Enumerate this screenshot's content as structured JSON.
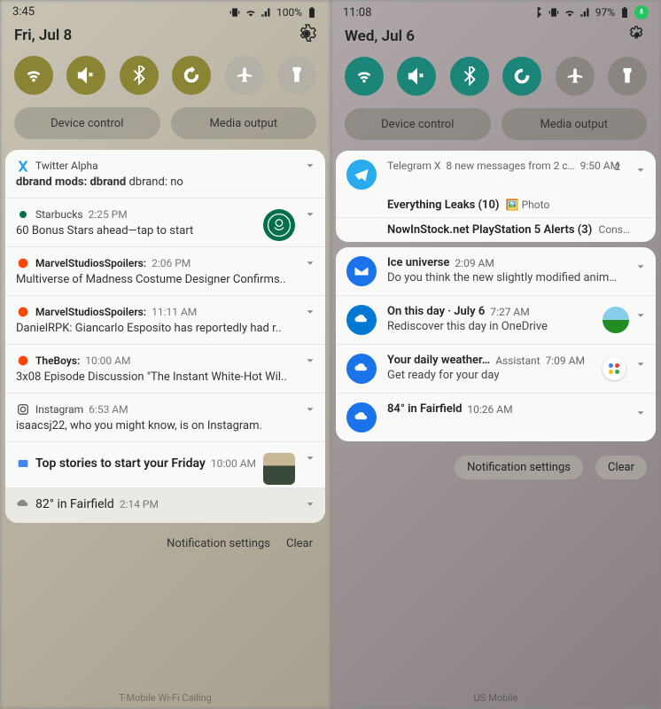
{
  "left": {
    "time": "3:45",
    "battery": "100%",
    "date": "Fri, Jul 8",
    "device_control": "Device control",
    "media_output": "Media output",
    "notifs": [
      {
        "app": "Twitter Alpha",
        "title": "dbrand mods: dbrand",
        "body": "dbrand: no"
      },
      {
        "app": "Starbucks",
        "time": "2:25 PM",
        "body": "60 Bonus Stars ahead—tap to start"
      },
      {
        "app": "MarvelStudiosSpoilers:",
        "time": "2:06 PM",
        "body": "Multiverse of Madness Costume Designer Confirms.."
      },
      {
        "app": "MarvelStudiosSpoilers:",
        "time": "11:11 AM",
        "body": "DanielRPK: Giancarlo Esposito has reportedly had r.."
      },
      {
        "app": "TheBoys:",
        "time": "10:00 AM",
        "body": "3x08 Episode Discussion \"The Instant White-Hot Wil.."
      },
      {
        "app": "Instagram",
        "time": "6:53 AM",
        "body": "isaacsj22, who you might know, is on Instagram."
      },
      {
        "title": "Top stories to start your Friday",
        "time": "10:00 AM"
      },
      {
        "title": "82° in Fairfield",
        "time": "2:14 PM"
      }
    ],
    "notif_settings": "Notification settings",
    "clear": "Clear",
    "carrier": "T-Mobile Wi-Fi Calling"
  },
  "right": {
    "time": "11:08",
    "battery": "97%",
    "date": "Wed, Jul 6",
    "device_control": "Device control",
    "media_output": "Media output",
    "telegram": {
      "app": "Telegram X",
      "summary": "8 new messages from 2 c…",
      "time": "9:50 AM",
      "count": "2",
      "sub1_title": "Everything Leaks (10)",
      "sub1_meta": "🖼️ Photo",
      "sub2_title": "NowInStock.net PlayStation 5 Alerts (3)",
      "sub2_meta": "Cons…"
    },
    "notifs": [
      {
        "app": "Ice universe",
        "time": "2:09 AM",
        "body": "Do you think the new slightly modified anim…"
      },
      {
        "app": "On this day · July 6",
        "time": "7:27 AM",
        "body": "Rediscover this day in OneDrive"
      },
      {
        "app": "Your daily weather…",
        "assistant": "Assistant",
        "time": "7:09 AM",
        "body": "Get ready for your day"
      },
      {
        "app": "84° in Fairfield",
        "time": "10:26 AM"
      }
    ],
    "notif_settings": "Notification settings",
    "clear": "Clear",
    "carrier": "US  Mobile"
  }
}
